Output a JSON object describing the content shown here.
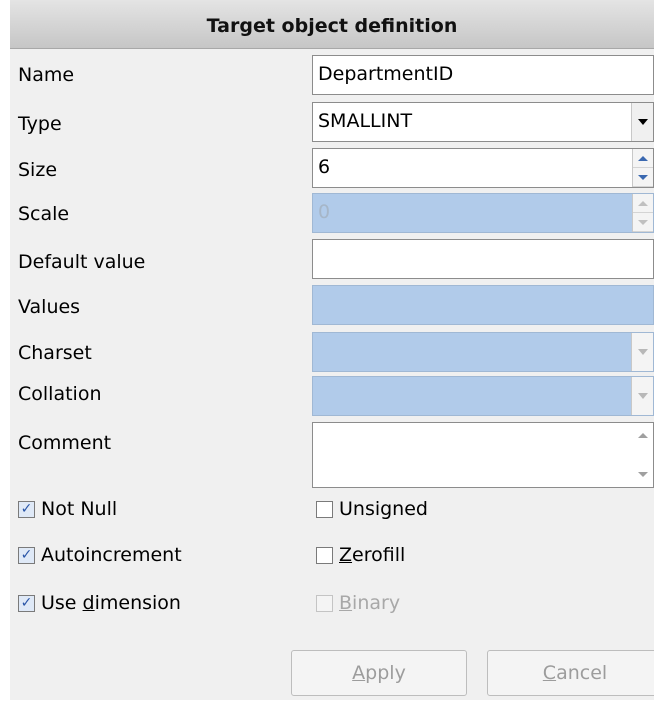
{
  "header": {
    "title": "Target object definition"
  },
  "fields": {
    "name": {
      "label": "Name",
      "value": "DepartmentID"
    },
    "type": {
      "label": "Type",
      "value": "SMALLINT"
    },
    "size": {
      "label": "Size",
      "value": "6"
    },
    "scale": {
      "label": "Scale",
      "value": "0"
    },
    "default_value": {
      "label": "Default value",
      "value": ""
    },
    "values": {
      "label": "Values",
      "value": ""
    },
    "charset": {
      "label": "Charset",
      "value": ""
    },
    "collation": {
      "label": "Collation",
      "value": ""
    },
    "comment": {
      "label": "Comment",
      "value": ""
    }
  },
  "checkboxes": {
    "not_null": {
      "label": "Not Null",
      "checked": true
    },
    "autoincrement": {
      "label": "Autoincrement",
      "checked": true
    },
    "use_dimension": {
      "label_pre": "Use ",
      "label_mnemonic": "d",
      "label_post": "imension",
      "checked": true
    },
    "unsigned": {
      "label": "Unsigned",
      "checked": false
    },
    "zerofill": {
      "label_mnemonic": "Z",
      "label_post": "erofill",
      "checked": false
    },
    "binary": {
      "label_mnemonic": "B",
      "label_post": "inary",
      "checked": false,
      "enabled": false
    }
  },
  "buttons": {
    "apply": {
      "mnemonic": "A",
      "rest": "pply"
    },
    "cancel": {
      "mnemonic": "C",
      "rest": "ancel"
    }
  },
  "check_glyph": "✓"
}
